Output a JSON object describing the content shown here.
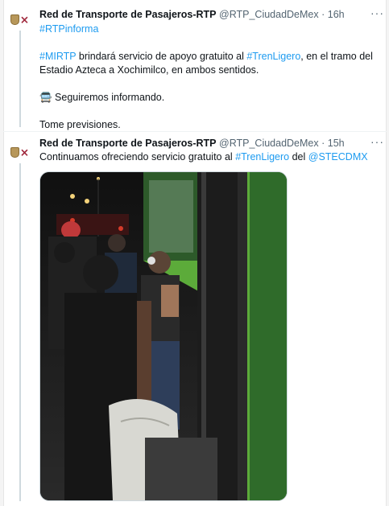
{
  "tweets": [
    {
      "author_name": "Red de Transporte de Pasajeros-RTP",
      "handle": "@RTP_CiudadDeMex",
      "separator": "·",
      "time": "16h",
      "hashtag_top": "#RTPinforma",
      "line1_hashtag": "#MIRTP",
      "line1_text": " brindará servicio de apoyo gratuito al ",
      "line1_hashtag2": "#TrenLigero",
      "line1_text2": ", en el tramo del Estadio Azteca a Xochimilco, en ambos sentidos.",
      "bus_emoji": "🚍",
      "line2": " Seguiremos informando.",
      "line3": "Tome previsiones."
    },
    {
      "author_name": "Red de Transporte de Pasajeros-RTP",
      "handle": "@RTP_CiudadDeMex",
      "separator": "·",
      "time": "15h",
      "text_start": "Continuamos ofreciendo servicio gratuito al ",
      "hashtag": "#TrenLigero",
      "text_mid": "  del ",
      "mention": "@STECDMX"
    }
  ],
  "more_label": "···",
  "icons": {
    "avatar": "rtp-shield-logo-icon",
    "more": "more-options-icon",
    "bus": "bus-emoji-icon"
  },
  "colors": {
    "link": "#1d9bf0",
    "secondary_text": "#536471",
    "bus_green": "#5cab3a"
  }
}
